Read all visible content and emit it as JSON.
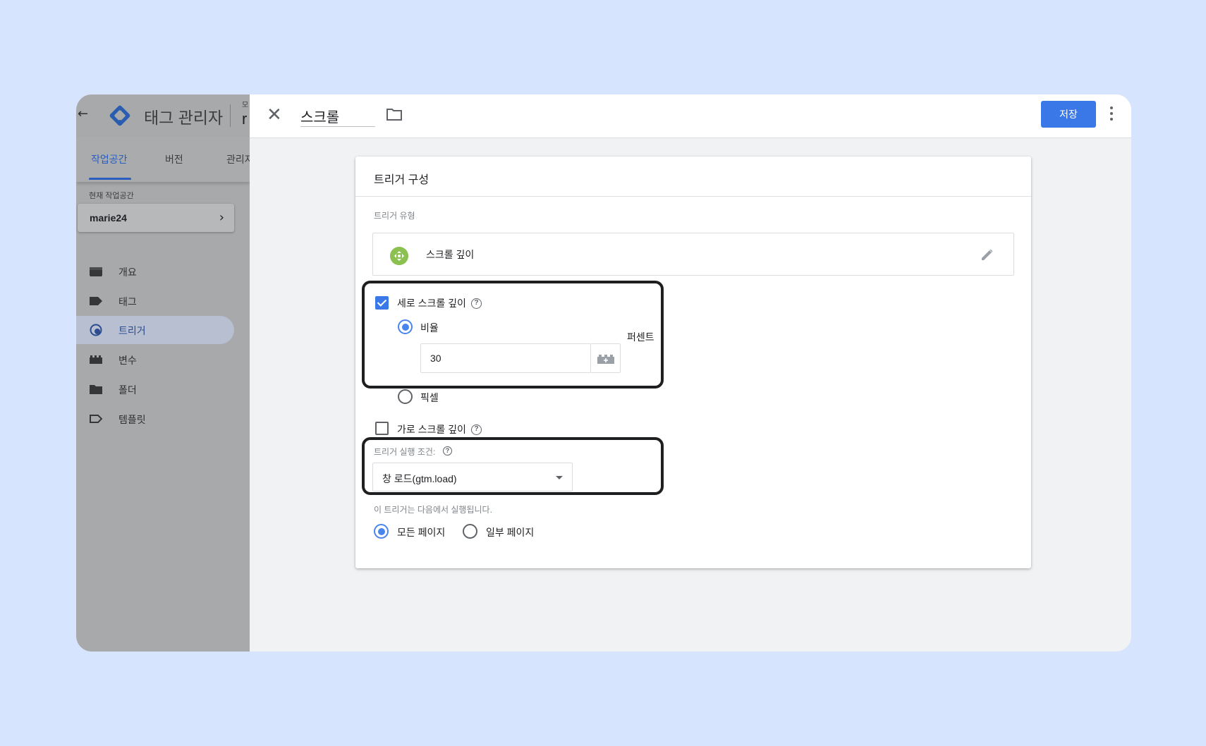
{
  "app": {
    "title": "태그 관리자",
    "account_mini": "모",
    "account_big": "r",
    "tabs": [
      "작업공간",
      "버전",
      "관리자"
    ],
    "workspace_label": "현재 작업공간",
    "workspace_name": "marie24",
    "nav": [
      {
        "label": "개요",
        "icon": "overview-icon"
      },
      {
        "label": "태그",
        "icon": "tag-icon"
      },
      {
        "label": "트리거",
        "icon": "trigger-icon"
      },
      {
        "label": "변수",
        "icon": "variable-icon"
      },
      {
        "label": "폴더",
        "icon": "folder-icon"
      },
      {
        "label": "템플릿",
        "icon": "template-icon"
      }
    ],
    "active_nav": "트리거"
  },
  "editor": {
    "name": "스크롤",
    "save_label": "저장",
    "card_title": "트리거 구성",
    "trigger_type_label": "트리거 유형",
    "trigger_type": "스크롤 깊이",
    "vertical_label": "세로 스크롤 깊이",
    "vertical_checked": true,
    "percent_label": "비율",
    "percent_value": "30",
    "percent_unit": "퍼센트",
    "pixel_label": "픽셀",
    "horizontal_label": "가로 스크롤 깊이",
    "horizontal_checked": false,
    "fire_condition_label": "트리거 실행 조건:",
    "fire_condition_value": "창 로드(gtm.load)",
    "fires_on_label": "이 트리거는 다음에서 실행됩니다.",
    "all_pages_label": "모든 페이지",
    "some_pages_label": "일부 페이지",
    "help_glyph": "?"
  },
  "colors": {
    "background": "#d6e5fd",
    "primary": "#3b78e7",
    "trigger_icon": "#8cc152",
    "highlight_border": "#1e1f21"
  }
}
